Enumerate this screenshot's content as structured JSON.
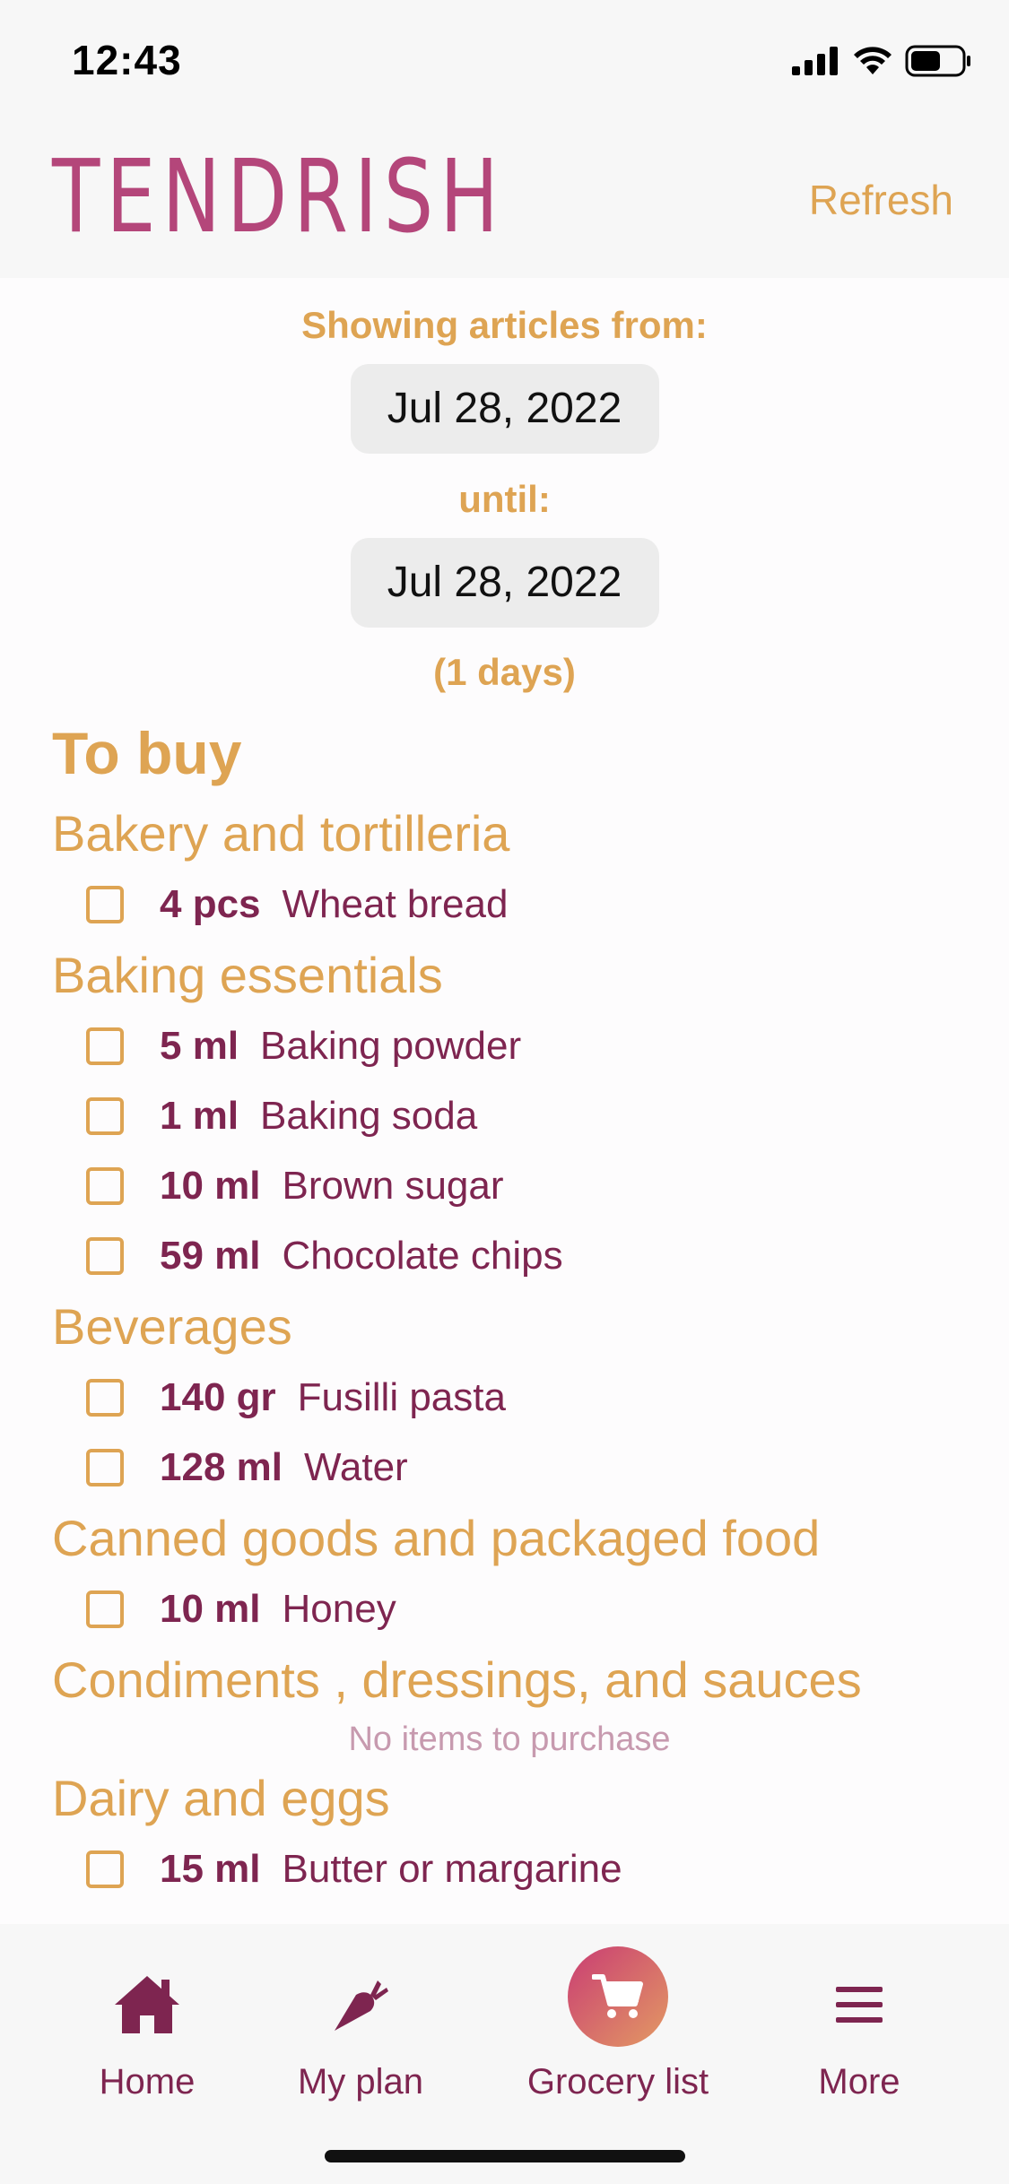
{
  "status_bar": {
    "time": "12:43"
  },
  "header": {
    "logo": "TENDRISH",
    "refresh_label": "Refresh"
  },
  "range": {
    "from_label": "Showing articles from:",
    "from_date": "Jul 28, 2022",
    "until_label": "until:",
    "until_date": "Jul 28, 2022",
    "days": "(1 days)"
  },
  "list": {
    "heading": "To buy",
    "categories": [
      {
        "title": "Bakery and tortilleria",
        "items": [
          {
            "qty": "4 pcs",
            "name": "Wheat bread"
          }
        ]
      },
      {
        "title": "Baking essentials",
        "items": [
          {
            "qty": "5 ml",
            "name": "Baking powder"
          },
          {
            "qty": "1 ml",
            "name": "Baking soda"
          },
          {
            "qty": "10 ml",
            "name": "Brown sugar"
          },
          {
            "qty": "59 ml",
            "name": "Chocolate chips"
          }
        ]
      },
      {
        "title": "Beverages",
        "items": [
          {
            "qty": "140 gr",
            "name": "Fusilli pasta"
          },
          {
            "qty": "128 ml",
            "name": "Water"
          }
        ]
      },
      {
        "title": "Canned goods and packaged food",
        "items": [
          {
            "qty": "10 ml",
            "name": "Honey"
          }
        ]
      },
      {
        "title": "Condiments , dressings, and sauces",
        "empty_text": "No items to purchase"
      },
      {
        "title": "Dairy and eggs",
        "items": [
          {
            "qty": "15 ml",
            "name": "Butter or margarine"
          }
        ]
      }
    ]
  },
  "nav": {
    "home": "Home",
    "plan": "My plan",
    "grocery": "Grocery list",
    "more": "More"
  },
  "colors": {
    "accent": "#dea453",
    "brand": "#b4467a",
    "text": "#7e2550"
  }
}
